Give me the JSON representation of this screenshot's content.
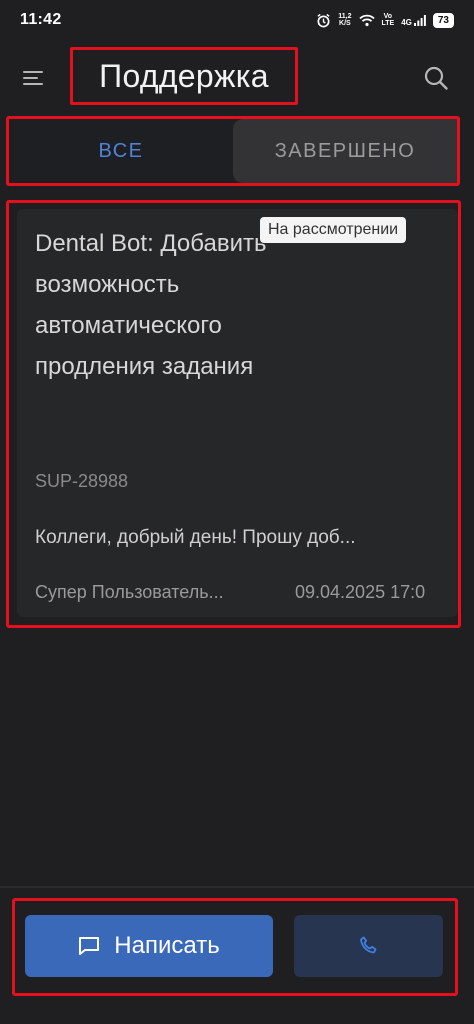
{
  "status_bar": {
    "time": "11:42",
    "speed_value": "11,2",
    "speed_unit": "K/S",
    "volte_top": "Vo",
    "volte_bottom": "LTE",
    "network": "4G",
    "battery": "73"
  },
  "header": {
    "title": "Поддержка",
    "menu_icon": "hamburger-icon",
    "search_icon": "search-icon"
  },
  "tabs": [
    {
      "label": "ВСЕ",
      "active": true
    },
    {
      "label": "ЗАВЕРШЕНО",
      "active": false
    }
  ],
  "ticket": {
    "title": "Dental Bot: Добавить возможность автоматического продления задания",
    "status": "На рассмотрении",
    "id": "SUP-28988",
    "preview": "Коллеги, добрый день! Прошу доб...",
    "author": "Супер Пользователь...",
    "date": "09.04.2025 17:0"
  },
  "actions": {
    "write_label": "Написать",
    "write_icon": "chat-icon",
    "call_icon": "phone-icon"
  },
  "colors": {
    "accent": "#4f82d9",
    "primary_button": "#3b69b9",
    "secondary_button": "#283550",
    "highlight_border": "#e5101d"
  }
}
